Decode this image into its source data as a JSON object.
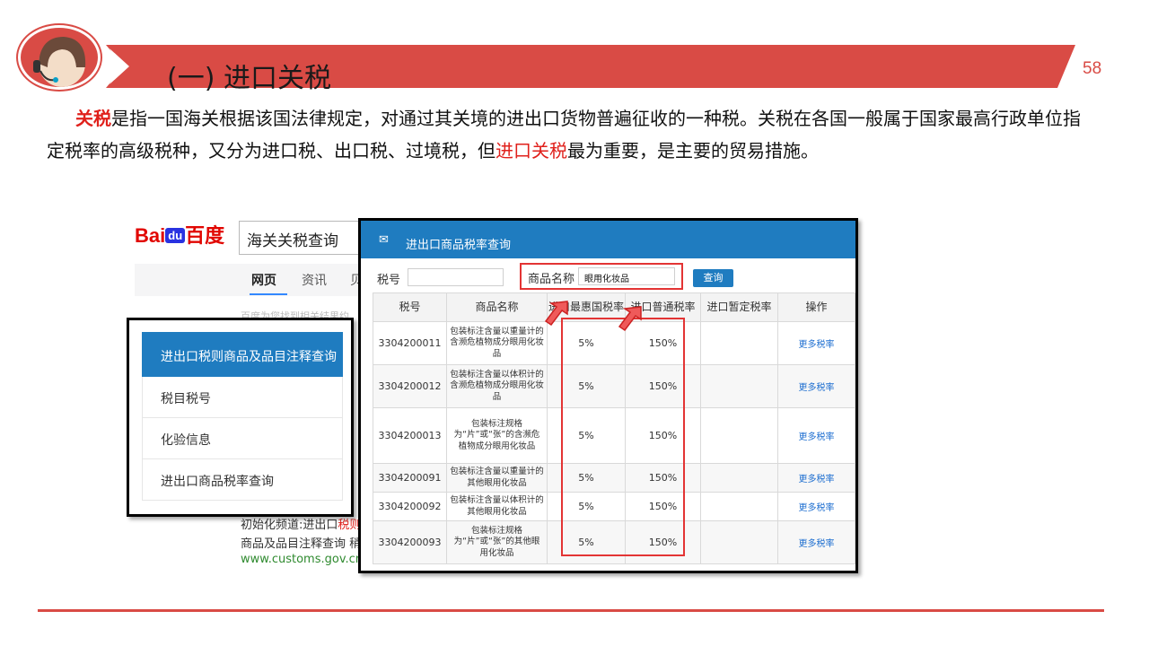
{
  "slide": {
    "title": "(一) 进口关税",
    "page_number": "58",
    "accent_color": "#d94b45"
  },
  "paragraph": {
    "term": "关税",
    "part1": "是指一国海关根据该国法律规定，对通过其关境的进出口货物普遍征收的一种税。关税在各国一般属于国家最高行政单位指定税率的高级税种，又分为进口税、出口税、过境税，但",
    "highlight": "进口关税",
    "part2": "最为重要，是主要的贸易措施。"
  },
  "baidu": {
    "logo_text": "Bai",
    "logo_du": "du",
    "logo_cn": "百度",
    "search_value": "海关关税查询",
    "tabs": [
      "网页",
      "资讯",
      "贝"
    ],
    "faint_text": "百度为您找到相关结果约",
    "result_line1": "初始化频道:进出口",
    "result_line1_red": "税则",
    "result_line2": "商品及品目注释查询 稍",
    "result_url": "www.customs.gov.cn/c"
  },
  "left_menu": {
    "items": [
      "进出口税则商品及品目注释查询",
      "税目税号",
      "化验信息",
      "进出口商品税率查询"
    ]
  },
  "panel": {
    "title": "进出口商品税率查询",
    "tax_no_label": "税号",
    "name_label": "商品名称",
    "name_value": "眼用化妆品",
    "query_button": "查询",
    "columns": [
      "税号",
      "商品名称",
      "进口最惠国税率",
      "进口普通税率",
      "进口暂定税率",
      "操作"
    ],
    "rows": [
      {
        "code": "3304200011",
        "name": "包装标注含量以重量计的含濒危植物成分眼用化妆品",
        "mfn": "5%",
        "general": "150%",
        "provisional": "",
        "action": "更多税率"
      },
      {
        "code": "3304200012",
        "name": "包装标注含量以体积计的含濒危植物成分眼用化妆品",
        "mfn": "5%",
        "general": "150%",
        "provisional": "",
        "action": "更多税率"
      },
      {
        "code": "3304200013",
        "name": "包装标注规格为“片”或“张”的含濒危植物成分眼用化妆品",
        "mfn": "5%",
        "general": "150%",
        "provisional": "",
        "action": "更多税率"
      },
      {
        "code": "3304200091",
        "name": "包装标注含量以重量计的其他眼用化妆品",
        "mfn": "5%",
        "general": "150%",
        "provisional": "",
        "action": "更多税率"
      },
      {
        "code": "3304200092",
        "name": "包装标注含量以体积计的其他眼用化妆品",
        "mfn": "5%",
        "general": "150%",
        "provisional": "",
        "action": "更多税率"
      },
      {
        "code": "3304200093",
        "name": "包装标注规格为“片”或“张”的其他眼用化妆品",
        "mfn": "5%",
        "general": "150%",
        "provisional": "",
        "action": "更多税率"
      }
    ]
  }
}
